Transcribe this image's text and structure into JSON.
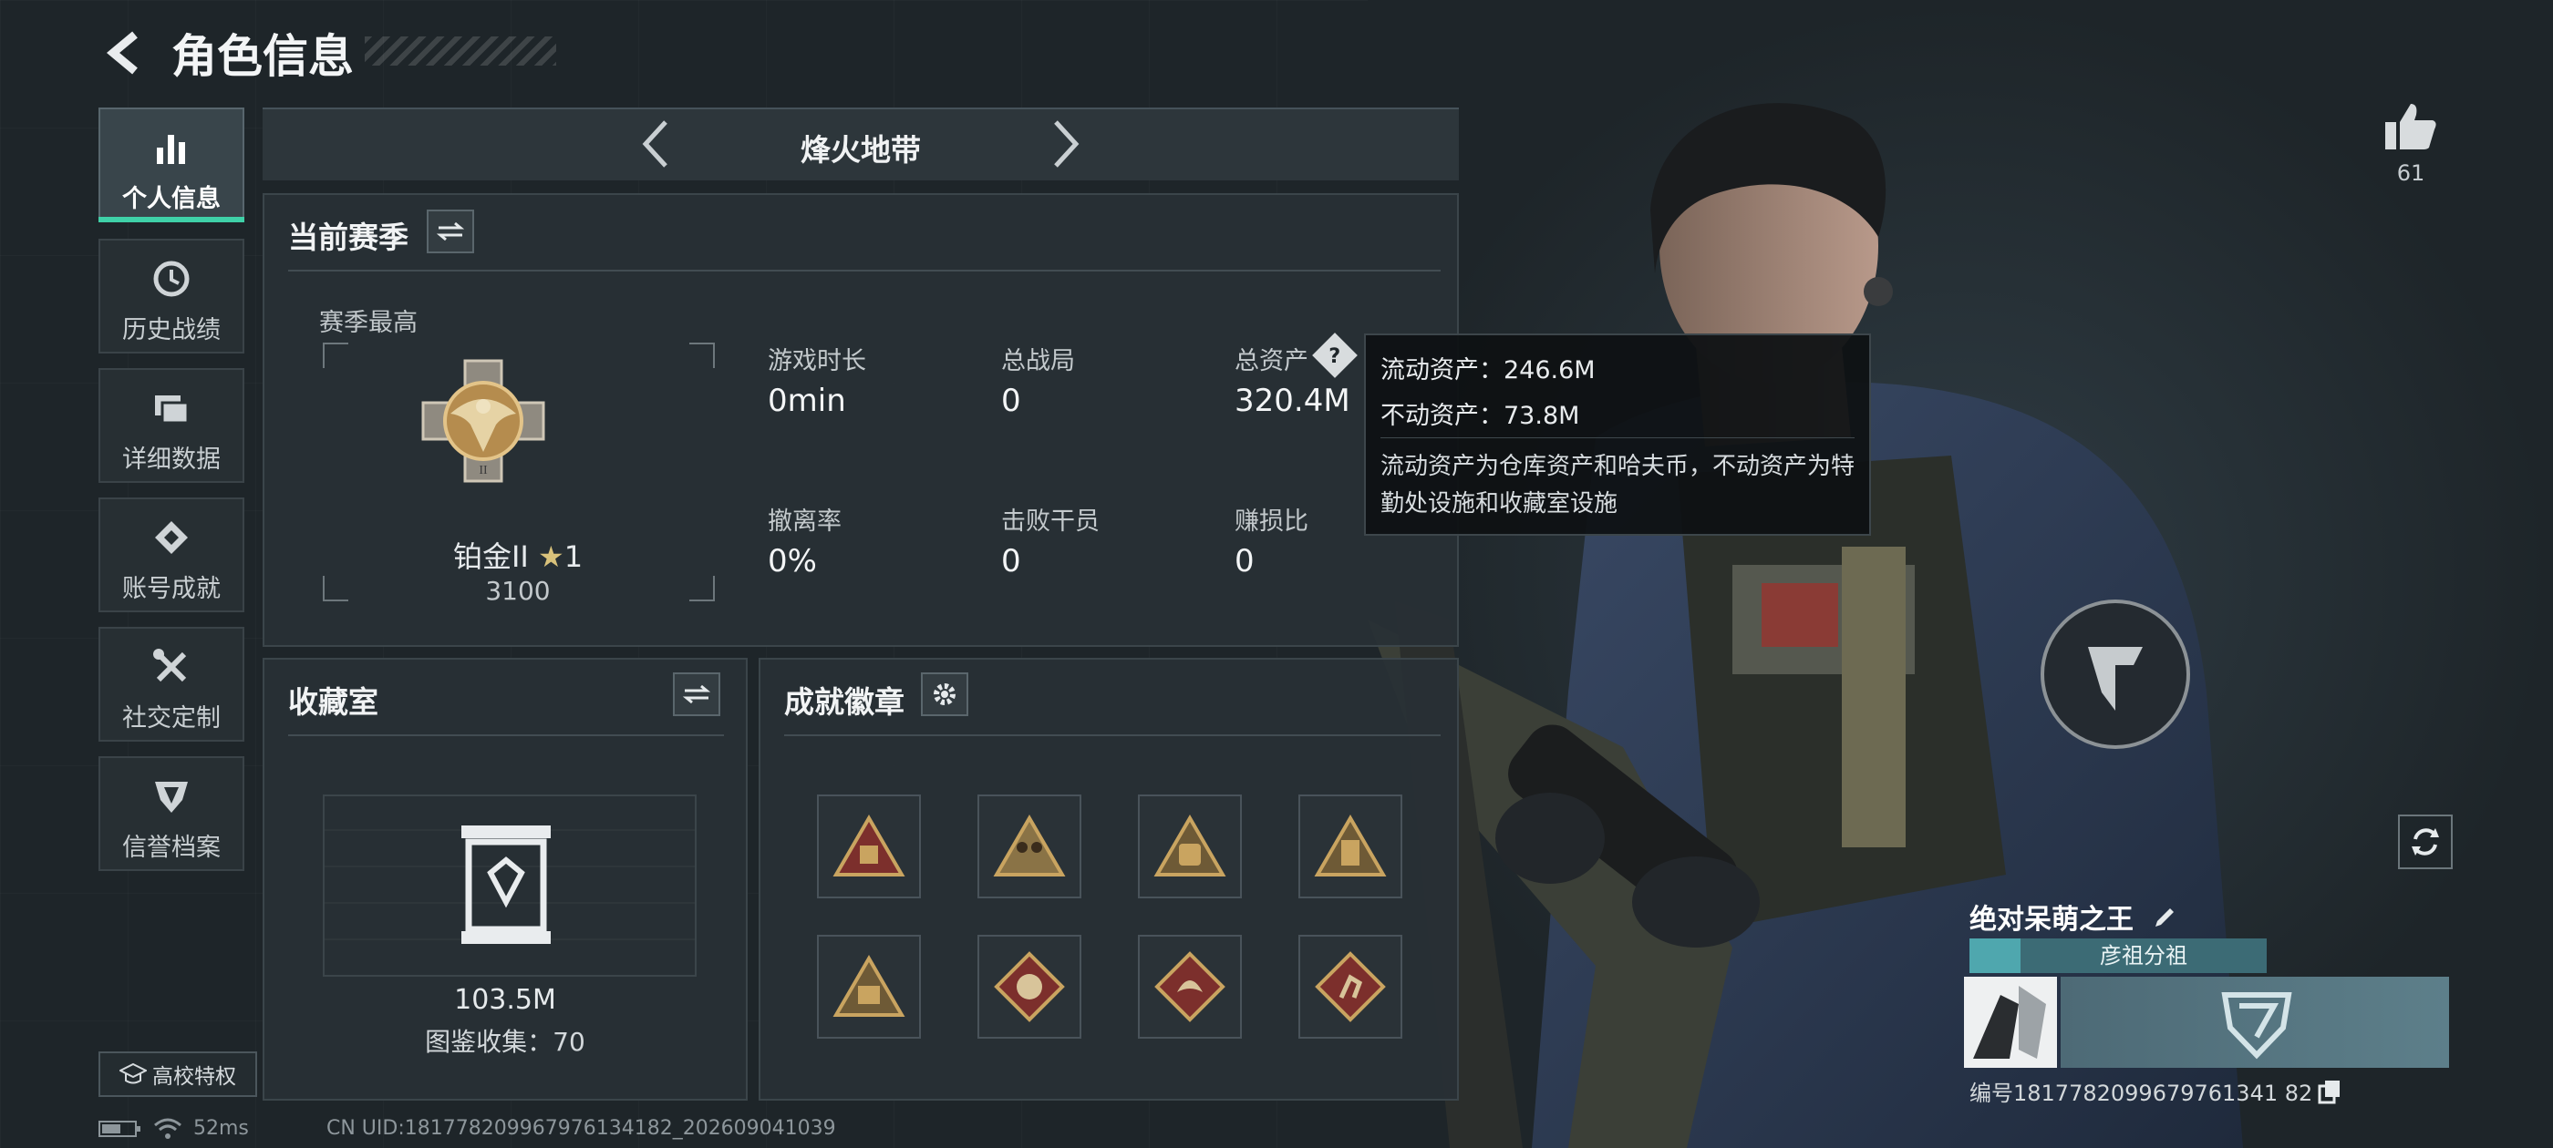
{
  "header": {
    "title": "角色信息"
  },
  "sidebar": {
    "items": [
      {
        "label": "个人信息",
        "icon": "bar-chart-icon",
        "active": true
      },
      {
        "label": "历史战绩",
        "icon": "history-clock-icon"
      },
      {
        "label": "详细数据",
        "icon": "folder-icon"
      },
      {
        "label": "账号成就",
        "icon": "achievement-icon"
      },
      {
        "label": "社交定制",
        "icon": "tools-icon"
      },
      {
        "label": "信誉档案",
        "icon": "shield-emblem-icon"
      }
    ],
    "campus_label": "高校特权"
  },
  "mode": {
    "name": "烽火地带"
  },
  "season": {
    "title": "当前赛季",
    "highest_label": "赛季最高",
    "rank_name": "铂金II",
    "rank_stars": "1",
    "rank_score": "3100",
    "stats": [
      {
        "label": "游戏时长",
        "value": "0min"
      },
      {
        "label": "总战局",
        "value": "0"
      },
      {
        "label": "总资产",
        "value": "320.4M"
      },
      {
        "label": "撤离率",
        "value": "0%"
      },
      {
        "label": "击败干员",
        "value": "0"
      },
      {
        "label": "赚损比",
        "value": "0"
      }
    ]
  },
  "tooltip": {
    "liquid": "流动资产：246.6M",
    "fixed": "不动资产：73.8M",
    "desc": "流动资产为仓库资产和哈夫币，不动资产为特勤处设施和收藏室设施"
  },
  "collection": {
    "title": "收藏室",
    "value": "103.5M",
    "catalog": "图鉴收集：70"
  },
  "badges": {
    "title": "成就徽章",
    "items": [
      {
        "icon": "gold-triangle-badge-icon"
      },
      {
        "icon": "gold-triangle-soldiers-badge-icon"
      },
      {
        "icon": "gold-triangle-bag-badge-icon"
      },
      {
        "icon": "gold-triangle-card-badge-icon"
      },
      {
        "icon": "gold-triangle-box-badge-icon"
      },
      {
        "icon": "red-diamond-wolf-badge-icon"
      },
      {
        "icon": "red-diamond-dragon-badge-icon"
      },
      {
        "icon": "red-diamond-runner-badge-icon"
      }
    ]
  },
  "likes": {
    "count": "61"
  },
  "player": {
    "name": "绝对呆萌之王",
    "team": "彦祖分祖",
    "uid_line": "编号1817782099679761341 82"
  },
  "status": {
    "ping": "52ms",
    "uid": "CN UID:181778209967976134182_202609041039"
  },
  "colors": {
    "accent": "#3fd1a8",
    "badge_gold": "#c9a460",
    "badge_red": "#7c2f2c"
  }
}
